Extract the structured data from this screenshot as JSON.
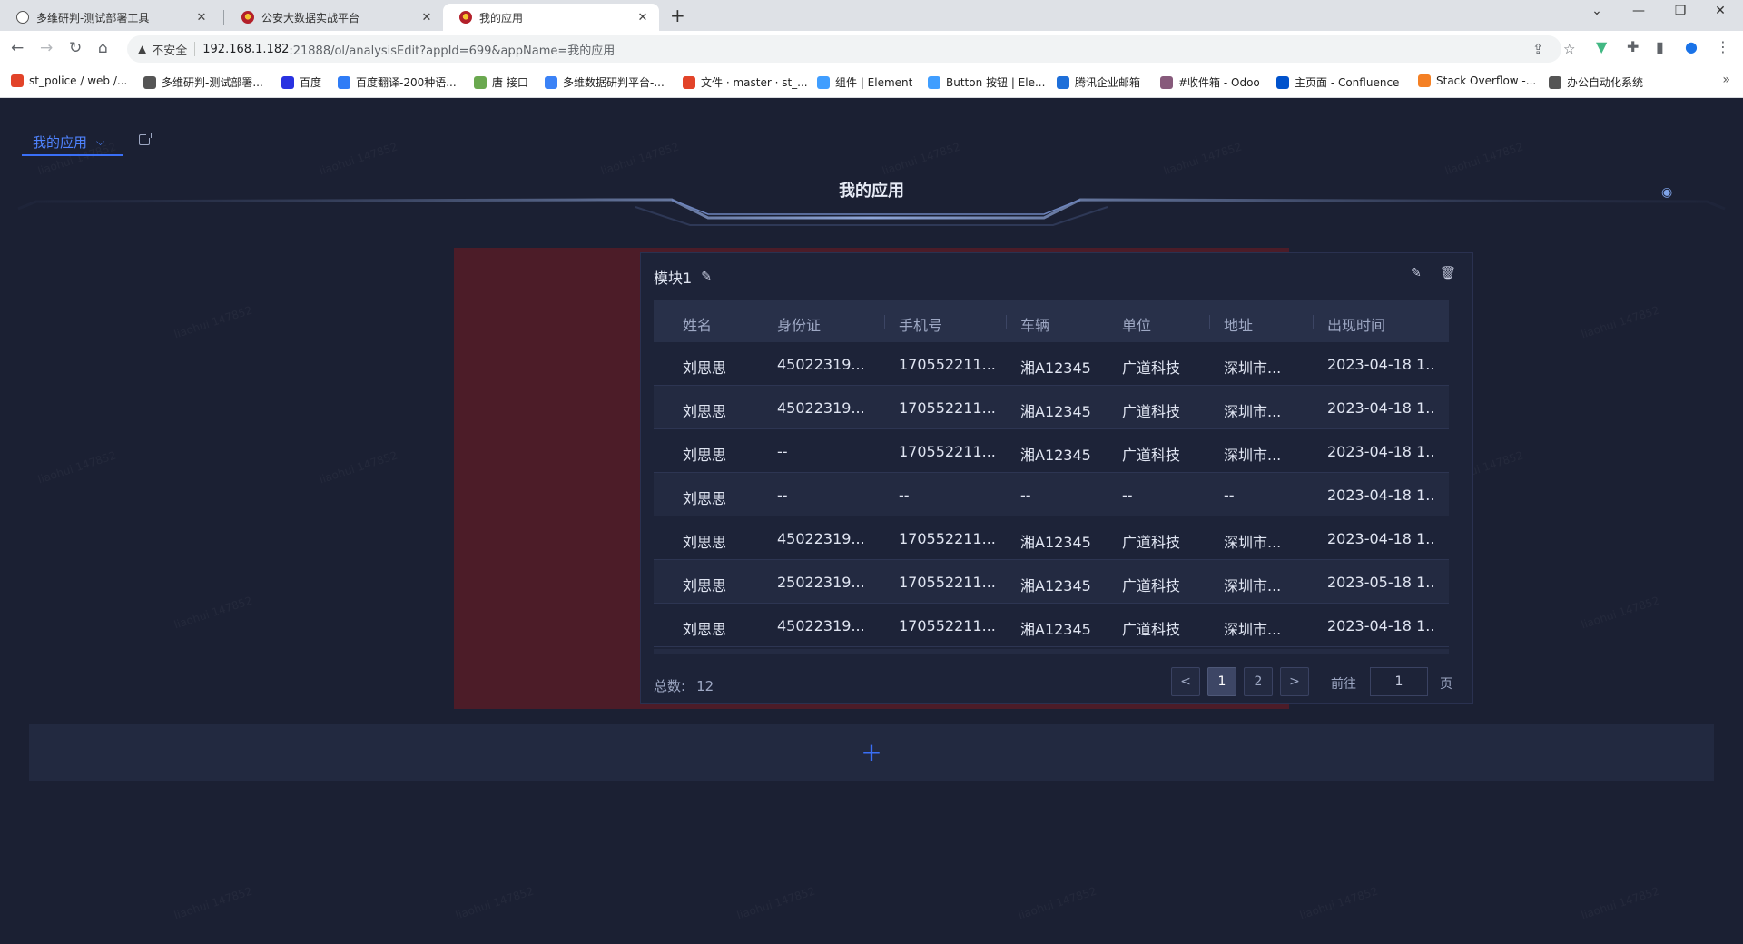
{
  "browser": {
    "tabs": [
      {
        "title": "多维研判-测试部署工具"
      },
      {
        "title": "公安大数据实战平台"
      },
      {
        "title": "我的应用"
      }
    ],
    "address": {
      "security_label": "不安全",
      "url_host": "192.168.1.182",
      "url_rest": ":21888/ol/analysisEdit?appId=699&appName=我的应用"
    },
    "bookmarks": [
      {
        "label": "st_police / web /...",
        "icon": "gitlab-icon",
        "color": "#e24329"
      },
      {
        "label": "多维研判-测试部署...",
        "icon": "globe-icon",
        "color": "#555555"
      },
      {
        "label": "百度",
        "icon": "baidu-icon",
        "color": "#2932e1"
      },
      {
        "label": "百度翻译-200种语...",
        "icon": "translate-icon",
        "color": "#2f7cf6"
      },
      {
        "label": "唐 接口",
        "icon": "api-icon",
        "color": "#6aa84f"
      },
      {
        "label": "多维数据研判平台-...",
        "icon": "app-icon",
        "color": "#3b82f6"
      },
      {
        "label": "文件 · master · st_...",
        "icon": "gitlab-icon",
        "color": "#e24329"
      },
      {
        "label": "组件 | Element",
        "icon": "element-icon",
        "color": "#409eff"
      },
      {
        "label": "Button 按钮 | Ele...",
        "icon": "element-icon",
        "color": "#409eff"
      },
      {
        "label": "腾讯企业邮箱",
        "icon": "mail-icon",
        "color": "#1e6fd9"
      },
      {
        "label": "#收件箱 - Odoo",
        "icon": "odoo-icon",
        "color": "#875a7b"
      },
      {
        "label": "主页面 - Confluence",
        "icon": "confluence-icon",
        "color": "#0052cc"
      },
      {
        "label": "Stack Overflow -...",
        "icon": "stackoverflow-icon",
        "color": "#f48024"
      },
      {
        "label": "办公自动化系统",
        "icon": "globe-icon",
        "color": "#555555"
      }
    ]
  },
  "app": {
    "selector_label": "我的应用",
    "header_title": "我的应用",
    "module": {
      "title": "模块1",
      "columns": [
        "姓名",
        "身份证",
        "手机号",
        "车辆",
        "单位",
        "地址",
        "出现时间"
      ],
      "rows": [
        [
          "刘思思",
          "45022319...",
          "170552211...",
          "湘A12345",
          "广道科技",
          "深圳市...",
          "2023-04-18 1..."
        ],
        [
          "刘思思",
          "45022319...",
          "170552211...",
          "湘A12345",
          "广道科技",
          "深圳市...",
          "2023-04-18 1..."
        ],
        [
          "刘思思",
          "--",
          "170552211...",
          "湘A12345",
          "广道科技",
          "深圳市...",
          "2023-04-18 1..."
        ],
        [
          "刘思思",
          "--",
          "--",
          "--",
          "--",
          "--",
          "2023-04-18 1..."
        ],
        [
          "刘思思",
          "45022319...",
          "170552211...",
          "湘A12345",
          "广道科技",
          "深圳市...",
          "2023-04-18 1..."
        ],
        [
          "刘思思",
          "25022319...",
          "170552211...",
          "湘A12345",
          "广道科技",
          "深圳市...",
          "2023-05-18 1..."
        ],
        [
          "刘思思",
          "45022319...",
          "170552211...",
          "湘A12345",
          "广道科技",
          "深圳市...",
          "2023-04-18 1..."
        ]
      ],
      "total_label": "总数:",
      "total_value": "12",
      "pages": [
        "1",
        "2"
      ],
      "current_page": "1",
      "goto_label": "前往",
      "goto_value": "1",
      "page_suffix": "页"
    },
    "add_symbol": "+",
    "watermark_text": "liaohui 147852",
    "colors": {
      "accent": "#3a6ff7",
      "background": "#1b2033",
      "panel": "#1d2338",
      "highlight_block": "#4c1c28"
    }
  }
}
